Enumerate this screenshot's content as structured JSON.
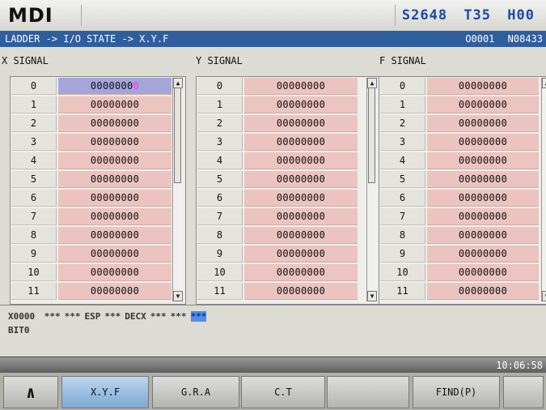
{
  "header": {
    "mode": "MDI",
    "spindle": "S2648",
    "tool": "T35",
    "h_code": "H00",
    "colors": {
      "mode": "#111111",
      "spindle": "#1b4aa3",
      "tool": "#1b4aa3",
      "h_code": "#1b4aa3"
    }
  },
  "breadcrumb": {
    "path": "LADDER -> I/O STATE -> X.Y.F",
    "program": "O0001",
    "block": "N08433"
  },
  "panels": [
    {
      "title": "X SIGNAL",
      "rows": [
        {
          "index": "0",
          "value": "0000000",
          "cursor_digit": "0",
          "selected": true
        },
        {
          "index": "1",
          "value": "00000000"
        },
        {
          "index": "2",
          "value": "00000000"
        },
        {
          "index": "3",
          "value": "00000000"
        },
        {
          "index": "4",
          "value": "00000000"
        },
        {
          "index": "5",
          "value": "00000000"
        },
        {
          "index": "6",
          "value": "00000000"
        },
        {
          "index": "7",
          "value": "00000000"
        },
        {
          "index": "8",
          "value": "00000000"
        },
        {
          "index": "9",
          "value": "00000000"
        },
        {
          "index": "10",
          "value": "00000000"
        },
        {
          "index": "11",
          "value": "00000000"
        }
      ]
    },
    {
      "title": "Y SIGNAL",
      "rows": [
        {
          "index": "0",
          "value": "00000000"
        },
        {
          "index": "1",
          "value": "00000000"
        },
        {
          "index": "2",
          "value": "00000000"
        },
        {
          "index": "3",
          "value": "00000000"
        },
        {
          "index": "4",
          "value": "00000000"
        },
        {
          "index": "5",
          "value": "00000000"
        },
        {
          "index": "6",
          "value": "00000000"
        },
        {
          "index": "7",
          "value": "00000000"
        },
        {
          "index": "8",
          "value": "00000000"
        },
        {
          "index": "9",
          "value": "00000000"
        },
        {
          "index": "10",
          "value": "00000000"
        },
        {
          "index": "11",
          "value": "00000000"
        }
      ]
    },
    {
      "title": "F SIGNAL",
      "rows": [
        {
          "index": "0",
          "value": "00000000"
        },
        {
          "index": "1",
          "value": "00000000"
        },
        {
          "index": "2",
          "value": "00000000"
        },
        {
          "index": "3",
          "value": "00000000"
        },
        {
          "index": "4",
          "value": "00000000"
        },
        {
          "index": "5",
          "value": "00000000"
        },
        {
          "index": "6",
          "value": "00000000"
        },
        {
          "index": "7",
          "value": "00000000"
        },
        {
          "index": "8",
          "value": "00000000"
        },
        {
          "index": "9",
          "value": "00000000"
        },
        {
          "index": "10",
          "value": "00000000"
        },
        {
          "index": "11",
          "value": "00000000"
        }
      ]
    }
  ],
  "bit_info": {
    "address": "X0000",
    "bits": [
      "***",
      "***",
      "ESP",
      "***",
      "DECX",
      "***",
      "***",
      "***"
    ],
    "highlighted_bit": 7,
    "bit_name": "BIT0"
  },
  "clock": "10:06:58",
  "softkeys": [
    {
      "label": "∧",
      "icon": "up-caret-icon"
    },
    {
      "label": "X.Y.F",
      "active": true
    },
    {
      "label": "G.R.A"
    },
    {
      "label": "C.T"
    },
    {
      "label": ""
    },
    {
      "label": "FIND(P)"
    },
    {
      "label": ""
    }
  ]
}
